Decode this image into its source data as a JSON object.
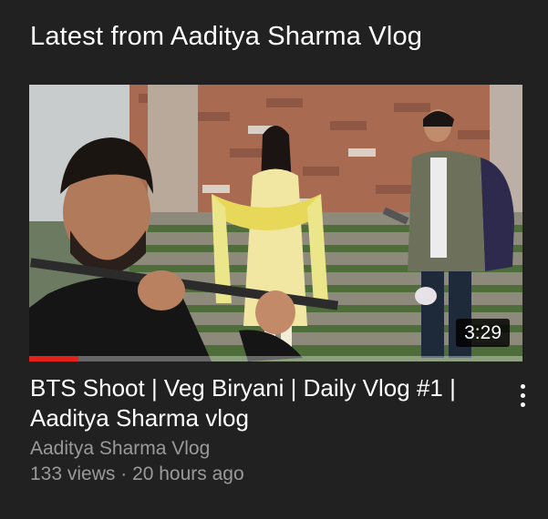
{
  "section": {
    "title": "Latest from Aaditya Sharma Vlog"
  },
  "video": {
    "duration": "3:29",
    "watched_fraction": 0.1,
    "title_line1": "BTS Shoot | Veg Biryani | Daily Vlog #1 |",
    "title_line2": "Aaditya Sharma vlog",
    "channel": "Aaditya Sharma Vlog",
    "views": "133 views",
    "separator": " · ",
    "age": "20 hours ago"
  },
  "icons": {
    "more": "more-vert-icon"
  },
  "colors": {
    "background": "#212121",
    "progress": "#e62117",
    "secondary_text": "#9a9a9a"
  }
}
